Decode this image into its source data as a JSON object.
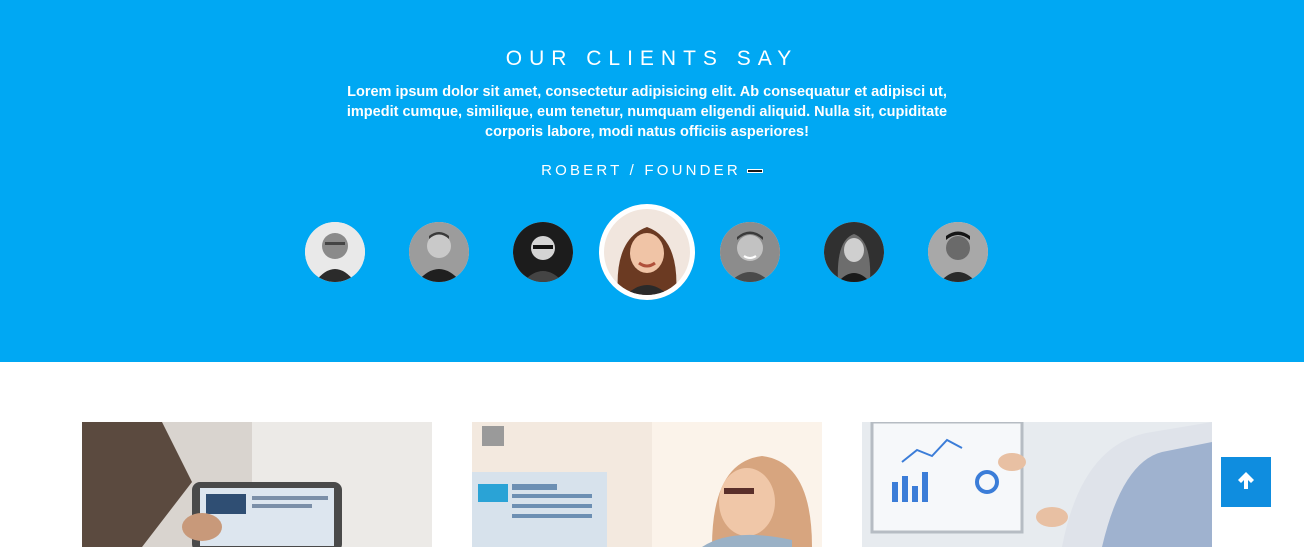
{
  "testimonials": {
    "title": "OUR CLIENTS SAY",
    "quote": "Lorem ipsum dolor sit amet, consectetur adipisicing elit. Ab consequatur et adipisci ut, impedit cumque, similique, eum tenetur, numquam eligendi aliquid. Nulla sit, cupiditate corporis labore, modi natus officiis asperiores!",
    "author": "ROBERT / FOUNDER",
    "active_index": 3,
    "client_count": 7
  },
  "cards": [
    "card-office-tablet",
    "card-dashboard-woman",
    "card-analytics-screen"
  ],
  "back_to_top_icon": "arrow-up-icon",
  "colors": {
    "section_bg": "#00a8f3",
    "back_to_top_bg": "#0f8ddf",
    "text": "#ffffff"
  }
}
